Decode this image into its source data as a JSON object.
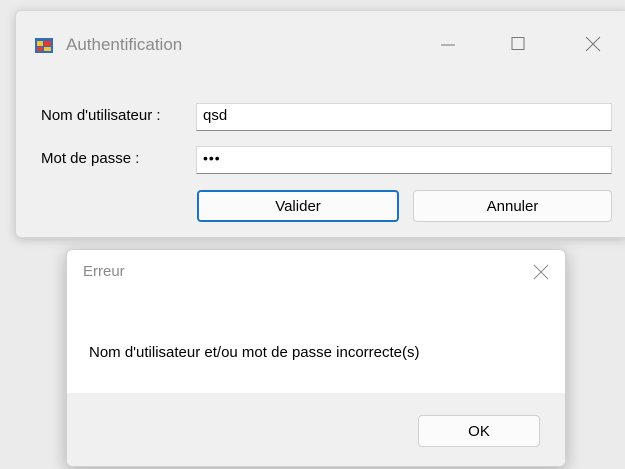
{
  "window": {
    "title": "Authentification",
    "icon": "winforms-app-icon",
    "controls": {
      "minimize": "minimize-icon",
      "maximize": "maximize-icon",
      "close": "close-icon"
    }
  },
  "form": {
    "username_label": "Nom d'utilisateur :",
    "username_value": "qsd",
    "password_label": "Mot de passe :",
    "password_value": "•••",
    "validate_label": "Valider",
    "cancel_label": "Annuler"
  },
  "dialog": {
    "title": "Erreur",
    "message": "Nom d'utilisateur et/ou mot de passe incorrecte(s)",
    "ok_label": "OK",
    "close_icon": "close-icon"
  },
  "colors": {
    "accent": "#1a73c7",
    "window_bg": "#f0f0f0",
    "dialog_bg": "#ffffff",
    "title_text": "#8a8a8a"
  }
}
